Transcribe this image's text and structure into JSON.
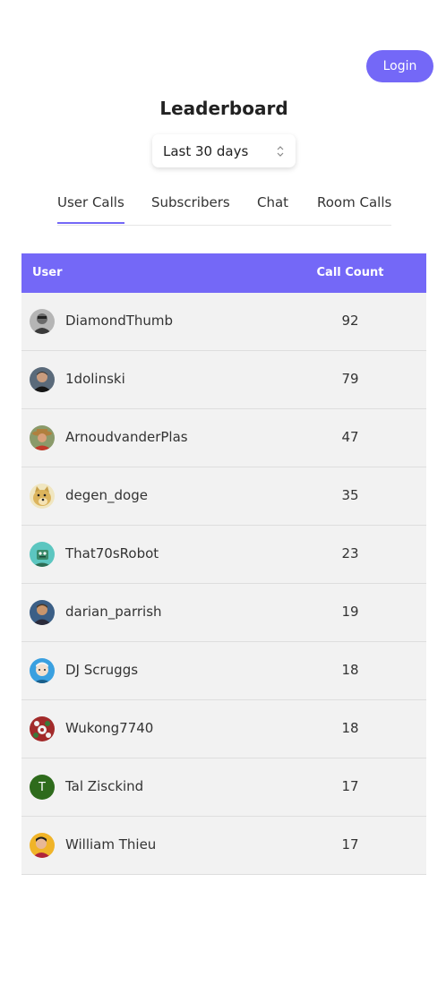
{
  "header": {
    "login_label": "Login",
    "title": "Leaderboard"
  },
  "period": {
    "selected": "Last 30 days"
  },
  "tabs": [
    {
      "label": "User Calls",
      "active": true
    },
    {
      "label": "Subscribers",
      "active": false
    },
    {
      "label": "Chat",
      "active": false
    },
    {
      "label": "Room Calls",
      "active": false
    }
  ],
  "table": {
    "columns": [
      "User",
      "Call Count"
    ],
    "rows": [
      {
        "user": "DiamondThumb",
        "count": "92",
        "avatar": "photo-avatar-grayscale"
      },
      {
        "user": "1dolinski",
        "count": "79",
        "avatar": "photo-avatar-dark"
      },
      {
        "user": "ArnoudvanderPlas",
        "count": "47",
        "avatar": "photo-avatar-hat"
      },
      {
        "user": "degen_doge",
        "count": "35",
        "avatar": "doge-avatar"
      },
      {
        "user": "That70sRobot",
        "count": "23",
        "avatar": "robot-avatar"
      },
      {
        "user": "darian_parrish",
        "count": "19",
        "avatar": "photo-avatar-blue"
      },
      {
        "user": "DJ Scruggs",
        "count": "18",
        "avatar": "cartoon-avatar"
      },
      {
        "user": "Wukong7740",
        "count": "18",
        "avatar": "pattern-avatar"
      },
      {
        "user": "Tal Zisckind",
        "count": "17",
        "avatar": "initial-avatar",
        "initial": "T"
      },
      {
        "user": "William Thieu",
        "count": "17",
        "avatar": "photo-avatar-yellow"
      }
    ]
  },
  "colors": {
    "accent": "#7468f7",
    "row_bg": "#f2f2f2",
    "initial_avatar_bg": "#2e6b1c"
  }
}
